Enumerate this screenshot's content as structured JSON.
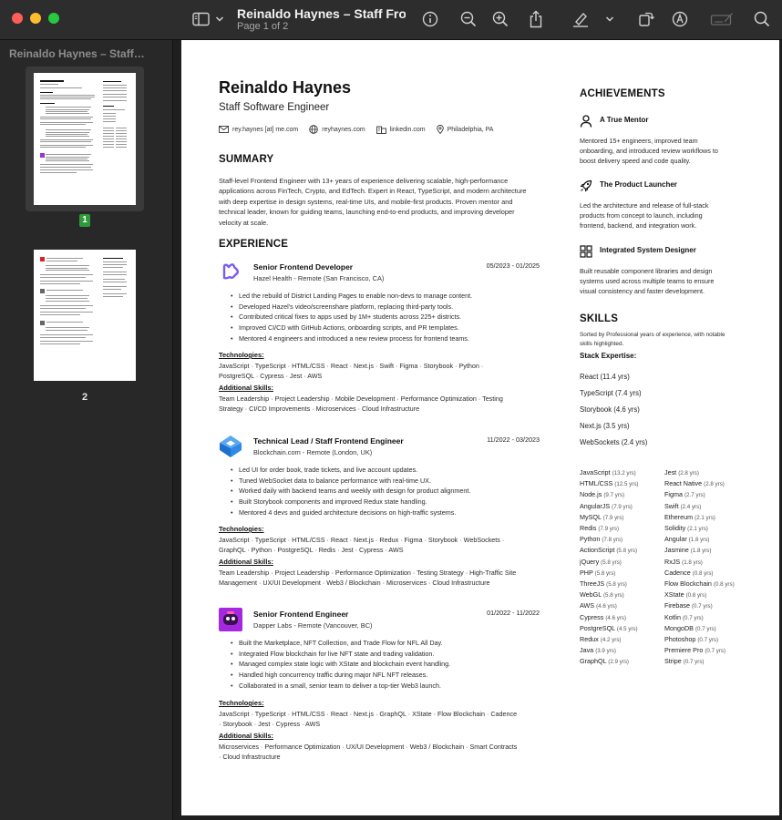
{
  "toolbar": {
    "doc_title": "Reinaldo Haynes – Staff Fron…",
    "page_indicator": "Page 1 of 2"
  },
  "sidebar": {
    "title": "Reinaldo Haynes – Staff…",
    "pages": [
      {
        "label": "1",
        "selected": true
      },
      {
        "label": "2",
        "selected": false
      }
    ]
  },
  "resume": {
    "name": "Reinaldo Haynes",
    "role": "Staff Software Engineer",
    "contacts": {
      "email": "rey.haynes [at] me.com",
      "website": "reyhaynes.com",
      "linkedin": "linkedin.com",
      "location": "Philadelphia, PA"
    },
    "summary_heading": "SUMMARY",
    "summary_lines": [
      "Staff-level Frontend Engineer with 13+ years of experience delivering scalable, high-performance",
      "applications across FinTech, Crypto, and EdTech. Expert in React, TypeScript, and modern architecture",
      "with deep expertise in design systems, real-time UIs, and mobile-first products. Proven mentor and",
      "technical leader, known for guiding teams, launching end-to-end products, and improving developer",
      "velocity at scale."
    ],
    "experience_heading": "EXPERIENCE",
    "jobs": [
      {
        "title": "Senior Frontend Developer",
        "company": "Hazel Health - Remote (San Francisco, CA)",
        "dates": "05/2023 - 01/2025",
        "bullets": [
          "Led the rebuild of District Landing Pages to enable non-devs to manage content.",
          "Developed Hazel's video/screenshare platform, replacing third-party tools.",
          "Contributed critical fixes to apps used by 1M+ students across 225+ districts.",
          "Improved CI/CD with GitHub Actions, onboarding scripts, and PR templates.",
          "Mentored 4 engineers and introduced a new review process for frontend teams."
        ],
        "tech_heading": "Technologies:",
        "tech_lines": [
          "JavaScript · TypeScript · HTML/CSS · React · Next.js · Swift · Figma · Storybook · Python ·",
          "PostgreSQL · Cypress · Jest · AWS"
        ],
        "skills_heading": "Additional Skills:",
        "skills_lines": [
          "Team Leadership · Project Leadership · Mobile Development · Performance Optimization · Testing",
          "Strategy · CI/CD Improvements · Microservices · Cloud Infrastructure"
        ]
      },
      {
        "title": "Technical Lead / Staff Frontend Engineer",
        "company": "Blockchain.com - Remote (London, UK)",
        "dates": "11/2022 - 03/2023",
        "bullets": [
          "Led UI for order book, trade tickets, and live account updates.",
          "Tuned WebSocket data to balance performance with real-time UX.",
          "Worked daily with backend teams and weekly with design for product alignment.",
          "Built Storybook components and improved Redux state handling.",
          "Mentored 4 devs and guided architecture decisions on high-traffic systems."
        ],
        "tech_heading": "Technologies:",
        "tech_lines": [
          "JavaScript · TypeScript · HTML/CSS · React · Next.js · Redux · Figma · Storybook · WebSockets ·",
          "GraphQL · Python · PostgreSQL · Redis · Jest · Cypress · AWS"
        ],
        "skills_heading": "Additional Skills:",
        "skills_lines": [
          "Team Leadership · Project Leadership · Performance Optimization · Testing Strategy · High-Traffic Site",
          "Management · UX/UI Development · Web3 / Blockchain · Microservices · Cloud Infrastructure"
        ]
      },
      {
        "title": "Senior Frontend Engineer",
        "company": "Dapper Labs - Remote (Vancouver, BC)",
        "dates": "01/2022 - 11/2022",
        "bullets": [
          "Built the Marketplace, NFT Collection, and Trade Flow for NFL All Day.",
          "Integrated Flow blockchain for live NFT state and trading validation.",
          "Managed complex state logic with XState and blockchain event handling.",
          "Handled high concurrency traffic during major NFL NFT releases.",
          "Collaborated in a small, senior team to deliver a top-tier Web3 launch."
        ],
        "tech_heading": "Technologies:",
        "tech_lines": [
          "JavaScript · TypeScript · HTML/CSS · React · Next.js · GraphQL · XState · Flow Blockchain · Cadence",
          "· Storybook · Jest · Cypress · AWS"
        ],
        "skills_heading": "Additional Skills:",
        "skills_lines": [
          "Microservices · Performance Optimization · UX/UI Development · Web3 / Blockchain · Smart Contracts",
          "· Cloud Infrastructure"
        ]
      }
    ],
    "achievements_heading": "ACHIEVEMENTS",
    "achievements": [
      {
        "icon": "person-icon",
        "title": "A True Mentor",
        "lines": [
          "Mentored 15+ engineers, improved team",
          "onboarding, and introduced review workflows to",
          "boost delivery speed and code quality."
        ]
      },
      {
        "icon": "rocket-icon",
        "title": "The Product Launcher",
        "lines": [
          "Led the architecture and release of full-stack",
          "products from concept to launch, including",
          "frontend, backend, and integration work."
        ]
      },
      {
        "icon": "grid-icon",
        "title": "Integrated System Designer",
        "lines": [
          "Built reusable component libraries and design",
          "systems used across multiple teams to ensure",
          "visual consistency and faster development."
        ]
      }
    ],
    "skills_heading": "SKILLS",
    "skills_note_lines": [
      "Sorted by Professional years of experience, with notable",
      "skills highlighted."
    ],
    "stack_heading": "Stack Expertise:",
    "stack": [
      "React (11.4 yrs)",
      "TypeScript (7.4 yrs)",
      "Storybook (4.6 yrs)",
      "Next.js (3.5 yrs)",
      "WebSockets (2.4 yrs)"
    ],
    "skills_left": [
      {
        "name": "JavaScript",
        "yrs": "(13.2 yrs)"
      },
      {
        "name": "HTML/CSS",
        "yrs": "(12.5 yrs)"
      },
      {
        "name": "Node.js",
        "yrs": "(9.7 yrs)"
      },
      {
        "name": "AngularJS",
        "yrs": "(7.9 yrs)"
      },
      {
        "name": "MySQL",
        "yrs": "(7.9 yrs)"
      },
      {
        "name": "Redis",
        "yrs": "(7.9 yrs)"
      },
      {
        "name": "Python",
        "yrs": "(7.8 yrs)"
      },
      {
        "name": "ActionScript",
        "yrs": "(5.8 yrs)"
      },
      {
        "name": "jQuery",
        "yrs": "(5.8 yrs)"
      },
      {
        "name": "PHP",
        "yrs": "(5.8 yrs)"
      },
      {
        "name": "ThreeJS",
        "yrs": "(5.8 yrs)"
      },
      {
        "name": "WebGL",
        "yrs": "(5.8 yrs)"
      },
      {
        "name": "AWS",
        "yrs": "(4.6 yrs)"
      },
      {
        "name": "Cypress",
        "yrs": "(4.6 yrs)"
      },
      {
        "name": "PostgreSQL",
        "yrs": "(4.5 yrs)"
      },
      {
        "name": "Redux",
        "yrs": "(4.2 yrs)"
      },
      {
        "name": "Java",
        "yrs": "(3.9 yrs)"
      },
      {
        "name": "GraphQL",
        "yrs": "(2.9 yrs)"
      }
    ],
    "skills_right": [
      {
        "name": "Jest",
        "yrs": "(2.8 yrs)"
      },
      {
        "name": "React Native",
        "yrs": "(2.8 yrs)"
      },
      {
        "name": "Figma",
        "yrs": "(2.7 yrs)"
      },
      {
        "name": "Swift",
        "yrs": "(2.4 yrs)"
      },
      {
        "name": "Ethereum",
        "yrs": "(2.1 yrs)"
      },
      {
        "name": "Solidity",
        "yrs": "(2.1 yrs)"
      },
      {
        "name": "Angular",
        "yrs": "(1.8 yrs)"
      },
      {
        "name": "Jasmine",
        "yrs": "(1.8 yrs)"
      },
      {
        "name": "RxJS",
        "yrs": "(1.8 yrs)"
      },
      {
        "name": "Cadence",
        "yrs": "(0.8 yrs)"
      },
      {
        "name": "Flow Blockchain",
        "yrs": "(0.8 yrs)"
      },
      {
        "name": "XState",
        "yrs": "(0.8 yrs)"
      },
      {
        "name": "Firebase",
        "yrs": "(0.7 yrs)"
      },
      {
        "name": "Kotlin",
        "yrs": "(0.7 yrs)"
      },
      {
        "name": "MongoDB",
        "yrs": "(0.7 yrs)"
      },
      {
        "name": "Photoshop",
        "yrs": "(0.7 yrs)"
      },
      {
        "name": "Premiere Pro",
        "yrs": "(0.7 yrs)"
      },
      {
        "name": "Stripe",
        "yrs": "(0.7 yrs)"
      }
    ]
  }
}
